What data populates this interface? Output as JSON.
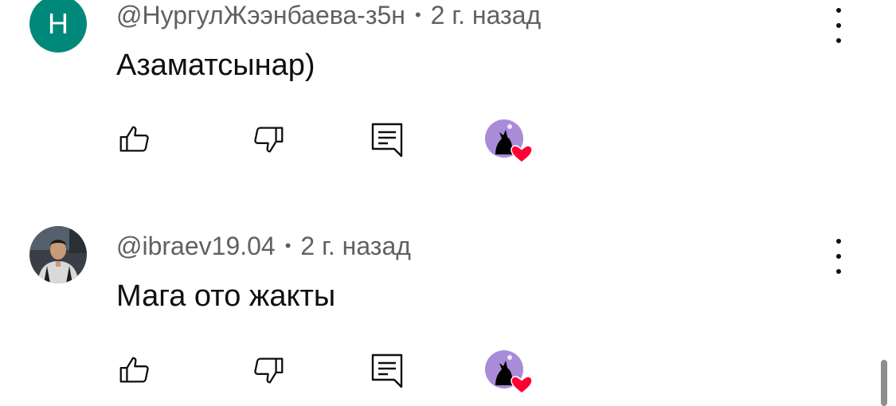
{
  "comments": [
    {
      "avatar_letter": "Н",
      "avatar_color": "#00897b",
      "author": "@НургулЖээнбаева-з5н",
      "separator": "•",
      "time": "2 г. назад",
      "text": "Азаматсынар)",
      "creator_heart": true
    },
    {
      "avatar_type": "photo",
      "author": "@ibraev19.04",
      "separator": "•",
      "time": "2 г. назад",
      "text": "Мага ото жакты",
      "creator_heart": true
    }
  ],
  "icons": {
    "like": "thumbs-up-icon",
    "dislike": "thumbs-down-icon",
    "reply": "comment-icon",
    "menu": "more-vertical-icon",
    "heart": "heart-icon"
  },
  "colors": {
    "meta_text": "#606060",
    "heart": "#ff0033",
    "creator_avatar_bg": "#a88cd8"
  }
}
